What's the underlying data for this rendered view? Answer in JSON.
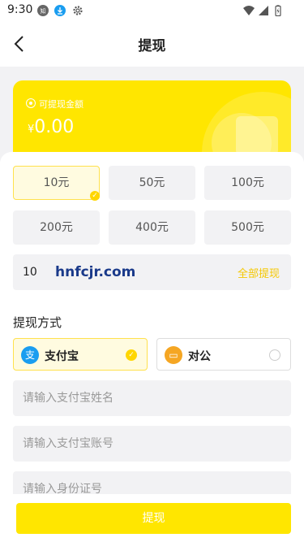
{
  "status_bar": {
    "time": "9:30"
  },
  "header": {
    "title": "提现"
  },
  "balance_card": {
    "label": "可提现金额",
    "currency": "¥",
    "amount": "0.00"
  },
  "amounts": [
    {
      "label": "10元",
      "selected": true
    },
    {
      "label": "50元",
      "selected": false
    },
    {
      "label": "100元",
      "selected": false
    },
    {
      "label": "200元",
      "selected": false
    },
    {
      "label": "400元",
      "selected": false
    },
    {
      "label": "500元",
      "selected": false
    }
  ],
  "amount_input": {
    "value": "10",
    "watermark": "hnfcjr.com",
    "withdraw_all": "全部提现"
  },
  "method_section": {
    "title": "提现方式",
    "options": [
      {
        "label": "支付宝",
        "icon": "alipay-icon",
        "color": "#1a9df0",
        "selected": true
      },
      {
        "label": "对公",
        "icon": "card-icon",
        "color": "#f5a623",
        "selected": false
      }
    ]
  },
  "fields": {
    "alipay_name_placeholder": "请输入支付宝姓名",
    "alipay_account_placeholder": "请输入支付宝账号",
    "id_number_placeholder": "请输入身份证号"
  },
  "submit": {
    "label": "提现"
  },
  "colors": {
    "accent": "#ffe600",
    "accent_text": "#f5c800"
  }
}
